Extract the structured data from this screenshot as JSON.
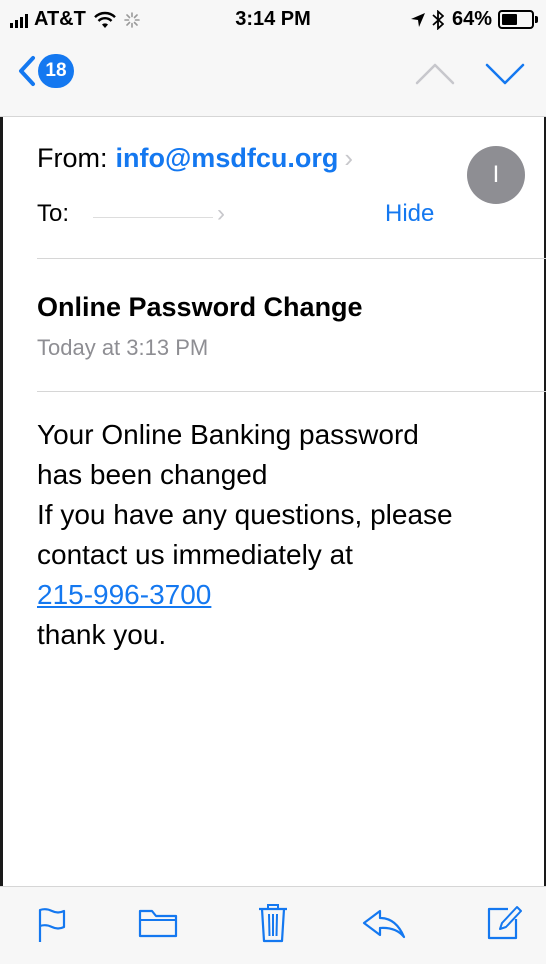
{
  "status_bar": {
    "carrier": "AT&T",
    "time": "3:14 PM",
    "battery_percent": "64%",
    "battery_level": 0.64,
    "icons": [
      "signal-icon",
      "wifi-icon",
      "activity-spinner-icon",
      "location-arrow-icon",
      "bluetooth-icon",
      "battery-icon"
    ]
  },
  "nav": {
    "back_icon": "chevron-left-icon",
    "unread_count": "18",
    "prev_icon": "chevron-up-icon",
    "next_icon": "chevron-down-icon"
  },
  "message": {
    "from_label": "From:",
    "from_address": "info@msdfcu.org",
    "to_label": "To:",
    "hide_label": "Hide",
    "avatar_initial": "I",
    "subject": "Online Password Change",
    "date": "Today at 3:13 PM",
    "body_lines": [
      "Your Online Banking password",
      "has been changed",
      "If you have any questions, please",
      "contact us immediately at"
    ],
    "phone": "215-996-3700",
    "closing": "thank you."
  },
  "toolbar": {
    "icons": [
      "flag-icon",
      "folder-icon",
      "trash-icon",
      "reply-icon",
      "compose-icon"
    ]
  },
  "colors": {
    "accent": "#1478f0",
    "bar_background": "#f7f7f7",
    "secondary_text": "#8e8e93",
    "avatar": "#8e8e93"
  }
}
